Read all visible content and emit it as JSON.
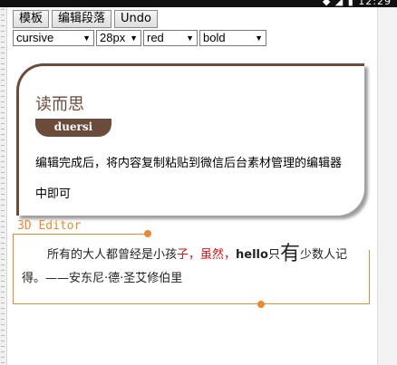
{
  "status_bar": {
    "time": "12:29",
    "icons": "◆ ◢ ▮"
  },
  "toolbar": {
    "template_btn": "模板",
    "edit_btn": "编辑段落",
    "undo_btn": "Undo"
  },
  "controls": {
    "font_family": "cursive",
    "font_size": "28px",
    "color": "red",
    "weight": "bold"
  },
  "card": {
    "title": "读而思",
    "tag": "duersi",
    "body": "编辑完成后，将内容复制粘贴到微信后台素材管理的编辑器中即可"
  },
  "section": {
    "label": "3D Editor",
    "text_1": "所有的大人都曾经是小孩",
    "text_red": "子，虽然，",
    "text_bold": "hello",
    "text_2": "只",
    "text_big": "有",
    "text_3": "少数人记得。——安东尼·德·圣艾修伯里"
  },
  "colors": {
    "brown": "#6b4c3b",
    "orange": "#e98a32",
    "red": "#d11111"
  }
}
